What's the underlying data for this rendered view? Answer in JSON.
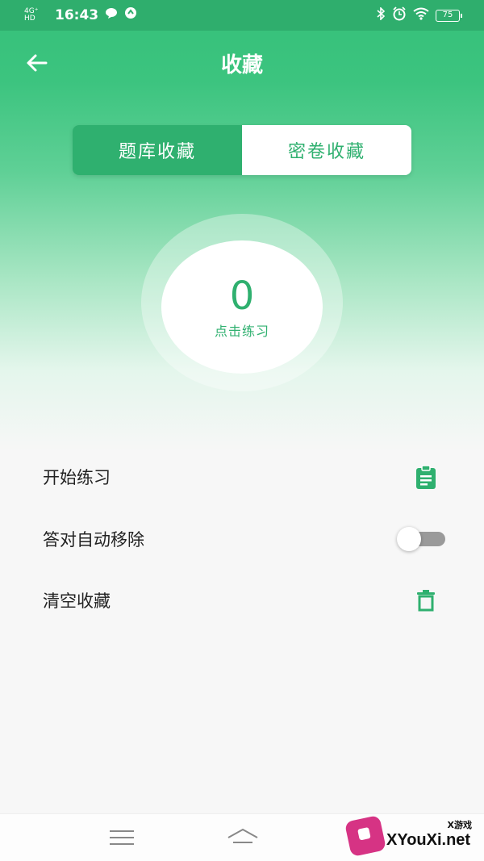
{
  "status_bar": {
    "network": "4G⁺ HD",
    "time": "16:43",
    "battery": "75"
  },
  "header": {
    "title": "收藏",
    "back_icon": "arrow-left-icon"
  },
  "segment": {
    "tabs": [
      {
        "label": "题库收藏",
        "active": true
      },
      {
        "label": "密卷收藏",
        "active": false
      }
    ]
  },
  "practice": {
    "count": "0",
    "label": "点击练习"
  },
  "settings": {
    "start": {
      "label": "开始练习",
      "icon": "clipboard-icon"
    },
    "auto_remove": {
      "label": "答对自动移除",
      "enabled": false
    },
    "clear": {
      "label": "清空收藏",
      "icon": "trash-icon"
    }
  },
  "watermark": {
    "small": "X游戏",
    "main": "XYouXi.net"
  },
  "colors": {
    "accent": "#2fb06f",
    "header_green": "#35c079"
  }
}
